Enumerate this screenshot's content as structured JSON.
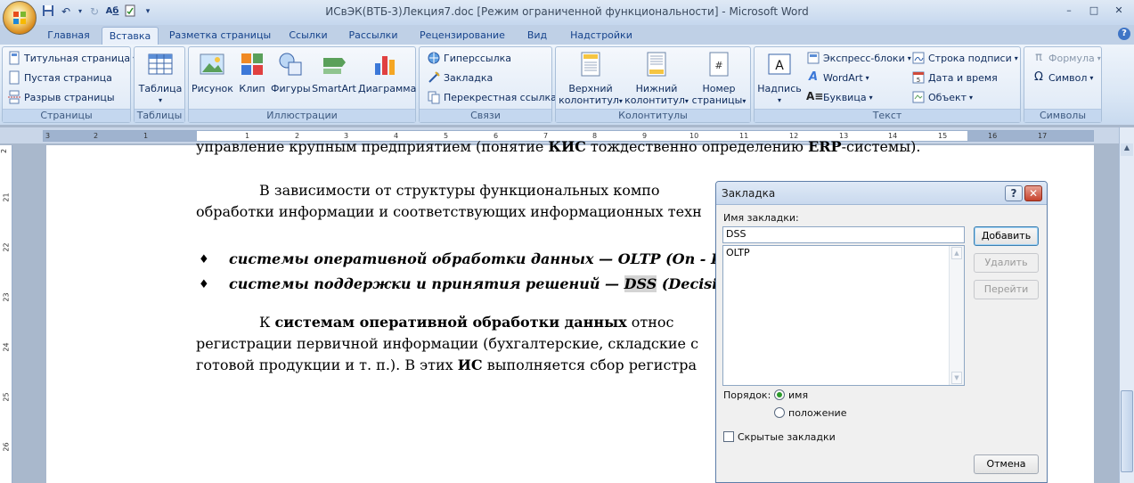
{
  "window": {
    "title": "ИСвЭК(ВТБ-3)Лекция7.doc [Режим ограниченной функциональности] - Microsoft Word",
    "controls": [
      "–",
      "□",
      "✕"
    ]
  },
  "qat": {
    "icons": [
      "save-icon",
      "undo-icon",
      "redo-icon",
      "spelling-icon",
      "document-check-icon",
      "qat-dropdown-icon"
    ]
  },
  "tabs": [
    "Главная",
    "Вставка",
    "Разметка страницы",
    "Ссылки",
    "Рассылки",
    "Рецензирование",
    "Вид",
    "Надстройки"
  ],
  "active_tab": "Вставка",
  "ribbon": {
    "pages": {
      "label": "Страницы",
      "items": [
        "Титульная страница",
        "Пустая страница",
        "Разрыв страницы"
      ]
    },
    "tables": {
      "label": "Таблицы",
      "button": "Таблица"
    },
    "illustrations": {
      "label": "Иллюстрации",
      "buttons": [
        "Рисунок",
        "Клип",
        "Фигуры",
        "SmartArt",
        "Диаграмма"
      ]
    },
    "links": {
      "label": "Связи",
      "items": [
        "Гиперссылка",
        "Закладка",
        "Перекрестная ссылка"
      ]
    },
    "headers": {
      "label": "Колонтитулы",
      "b1a": "Верхний",
      "b1b": "колонтитул",
      "b2a": "Нижний",
      "b2b": "колонтитул",
      "b3a": "Номер",
      "b3b": "страницы"
    },
    "text": {
      "label": "Текст",
      "button": "Надпись",
      "col1": [
        "Экспресс-блоки",
        "WordArt",
        "Буквица"
      ],
      "col2": [
        "Строка подписи",
        "Дата и время",
        "Объект"
      ]
    },
    "symbols": {
      "label": "Символы",
      "items": [
        "Формула",
        "Символ"
      ]
    }
  },
  "ruler": {
    "corner": "L",
    "numbers": [
      "3",
      "2",
      "1",
      "1",
      "2",
      "3",
      "4",
      "5",
      "6",
      "7",
      "8",
      "9",
      "10",
      "11",
      "12",
      "13",
      "14",
      "15",
      "16",
      "17"
    ],
    "vnumbers": [
      "2",
      "21",
      "22",
      "23",
      "24",
      "25",
      "26"
    ]
  },
  "document": {
    "line_top": {
      "t1": "управление крупным предприятием (понятие ",
      "b1": "КИС",
      "t2": " тождественно определению ",
      "b2": "ERP",
      "t3": "-системы)."
    },
    "para1_l1": "В зависимости от структуры функциональных компо",
    "para1_l2": "обработки информации и соответствующих информационных техн",
    "bullets": [
      {
        "text": "системы оперативной обработки данных — OLTP (On - Line",
        "pre": "",
        "hl": "",
        "post": ""
      },
      {
        "text": "",
        "pre": "системы поддержки и принятия решений — ",
        "hl": "DSS",
        "post": " (Decision S"
      }
    ],
    "para2_l1": {
      "t1": "К ",
      "b1": "системам оперативной обработки данных",
      "t2": " относ"
    },
    "para2_l2": "регистрации первичной информации (бухгалтерские, складские с",
    "para2_l3": {
      "t1": "готовой продукции и т. п.). В этих ",
      "b1": "ИС",
      "t2": " выполняется сбор регистра"
    }
  },
  "dialog": {
    "title": "Закладка",
    "help": "?",
    "close": "✕",
    "name_label": "Имя закладки:",
    "name_value": "DSS",
    "list_items": [
      "OLTP"
    ],
    "buttons": {
      "add": "Добавить",
      "delete": "Удалить",
      "goto": "Перейти",
      "cancel": "Отмена"
    },
    "order_label": "Порядок:",
    "order_options": [
      "имя",
      "положение"
    ],
    "order_selected": "имя",
    "hidden_label": "Скрытые закладки",
    "hidden_checked": false
  }
}
